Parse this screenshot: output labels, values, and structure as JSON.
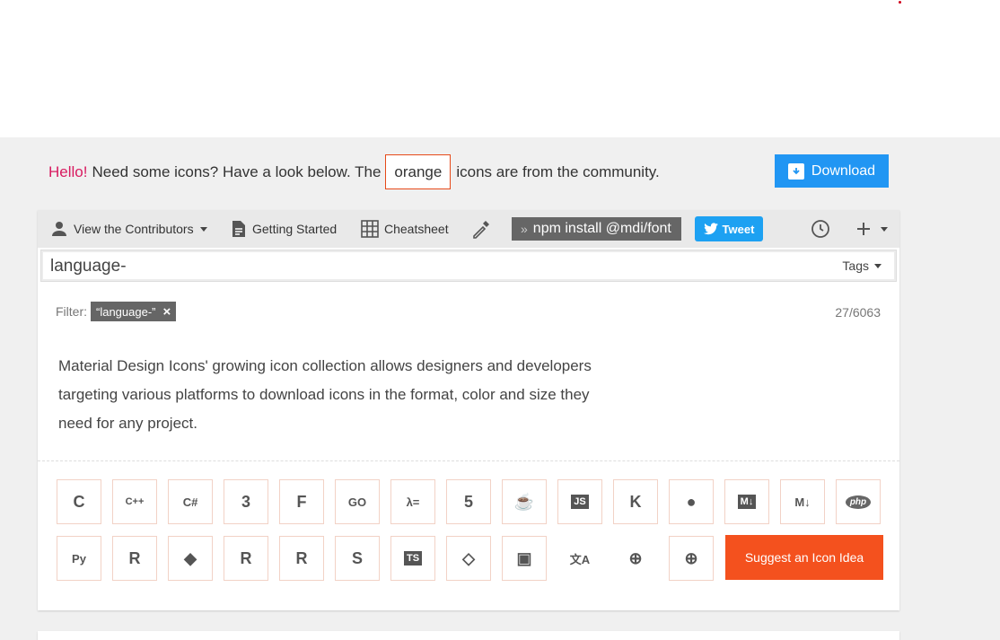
{
  "hello": {
    "greeting": "Hello!",
    "text_before": "Need some icons? Have a look below. The",
    "highlight": "orange",
    "text_after": "icons are from the community."
  },
  "download_label": "Download",
  "toolbar": {
    "contributors_label": "View the Contributors",
    "getting_started_label": "Getting Started",
    "cheatsheet_label": "Cheatsheet",
    "npm_command": "npm install @mdi/font",
    "tweet_label": "Tweet"
  },
  "search": {
    "value": "language-",
    "tags_label": "Tags"
  },
  "filter": {
    "label": "Filter:",
    "chip": "“language-”",
    "count": "27/6063"
  },
  "intro_text": "Material Design Icons' growing icon collection allows designers and developers targeting various platforms to download icons in the format, color and size they need for any project.",
  "icons_row1": [
    {
      "name": "language-c-icon",
      "glyph": "C"
    },
    {
      "name": "language-cpp-icon",
      "glyph": "C++"
    },
    {
      "name": "language-csharp-icon",
      "glyph": "C#"
    },
    {
      "name": "language-css3-icon",
      "glyph": "3"
    },
    {
      "name": "language-fortran-icon",
      "glyph": "F"
    },
    {
      "name": "language-go-icon",
      "glyph": "GO"
    },
    {
      "name": "language-haskell-icon",
      "glyph": "λ="
    },
    {
      "name": "language-html5-icon",
      "glyph": "5"
    },
    {
      "name": "language-java-icon",
      "glyph": "☕"
    },
    {
      "name": "language-javascript-icon",
      "glyph": "JS"
    },
    {
      "name": "language-kotlin-icon",
      "glyph": "K"
    },
    {
      "name": "language-lua-icon",
      "glyph": "●"
    },
    {
      "name": "language-markdown-icon",
      "glyph": "M↓"
    },
    {
      "name": "language-markdown-outline-icon",
      "glyph": "M↓"
    },
    {
      "name": "language-php-icon",
      "glyph": "php"
    }
  ],
  "icons_row2": [
    {
      "name": "language-python-icon",
      "glyph": "Py"
    },
    {
      "name": "language-r-icon",
      "glyph": "R"
    },
    {
      "name": "language-ruby-icon",
      "glyph": "◆"
    },
    {
      "name": "language-ruby-on-rails-icon",
      "glyph": "R"
    },
    {
      "name": "language-rust-icon",
      "glyph": "R"
    },
    {
      "name": "language-swift-icon",
      "glyph": "S"
    },
    {
      "name": "language-typescript-icon",
      "glyph": "TS"
    },
    {
      "name": "language-xaml-icon",
      "glyph": "◇"
    },
    {
      "name": "package-icon",
      "glyph": "▣"
    },
    {
      "name": "translate-icon",
      "glyph": "文A"
    },
    {
      "name": "web-icon",
      "glyph": "⊕"
    },
    {
      "name": "web-box-icon",
      "glyph": "⊕"
    }
  ],
  "suggest_label": "Suggest an Icon Idea",
  "colors": {
    "accent_orange": "#f4511e",
    "download_blue": "#2196f3",
    "tweet_blue": "#1da1f2",
    "hello_pink": "#d81b60"
  }
}
